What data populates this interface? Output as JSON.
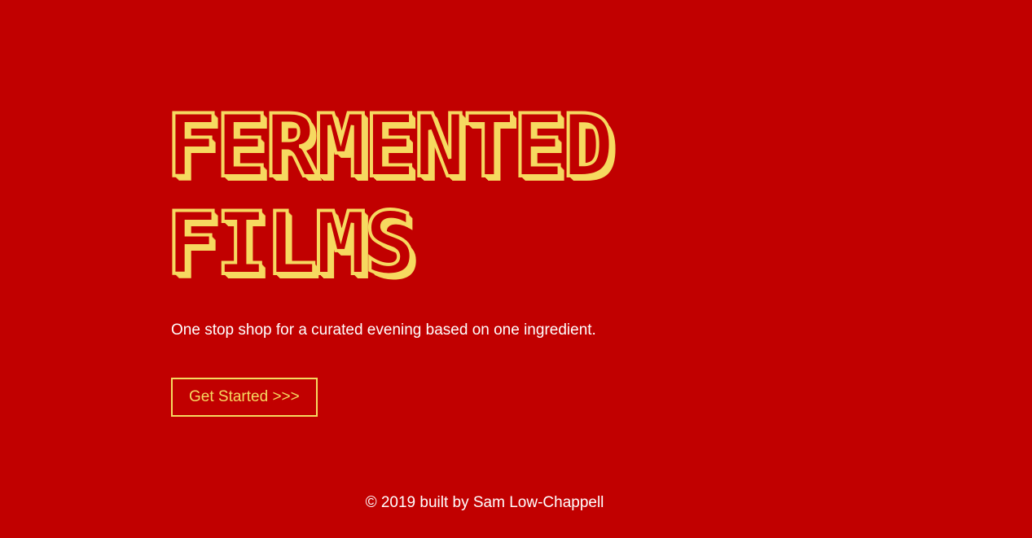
{
  "hero": {
    "title_line_1": "FERMENTED",
    "title_line_2": "FILMS",
    "tagline": "One stop shop for a curated evening based on one ingredient.",
    "cta_label": "Get Started >>>"
  },
  "footer": {
    "text": "© 2019 built by Sam Low-Chappell"
  },
  "colors": {
    "background": "#c10000",
    "accent": "#f6d960",
    "text": "#ffffff"
  }
}
